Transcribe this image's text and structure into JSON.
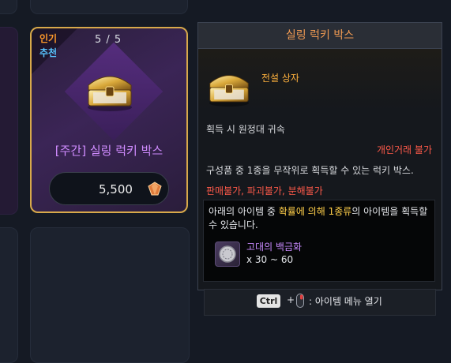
{
  "card": {
    "badge_popular": "인기",
    "badge_recommend": "추천",
    "stock": "5 / 5",
    "title": "[주간] 실링 럭키 박스",
    "price": "5,500",
    "price_icon": "crystal-gem-icon"
  },
  "tooltip": {
    "title": "실링 럭키 박스",
    "tier": "전설 상자",
    "bind": "획득 시 원정대 귀속",
    "trade": "개인거래 불가",
    "description": "구성품 중 1종을 무작위로 획득할 수 있는 럭키 박스.",
    "restrictions": "판매불가, 파괴불가, 분해불가",
    "info": {
      "line_prefix": "아래의 아이템 중 ",
      "highlight": "확률에 의해 1종류",
      "line_suffix": "의 아이템을 획득할 수 있습니다.",
      "item_name": "고대의 백금화",
      "item_qty": "x 30 ~ 60"
    },
    "hint": {
      "key": "Ctrl",
      "plus": "+",
      "text": ": 아이템 메뉴 열기"
    }
  },
  "colors": {
    "legendary": "#ffb13d",
    "warning": "#ff5a4a",
    "title_orange": "#f09a52",
    "purple_name": "#c98aff",
    "card_border": "#d8a94a"
  }
}
